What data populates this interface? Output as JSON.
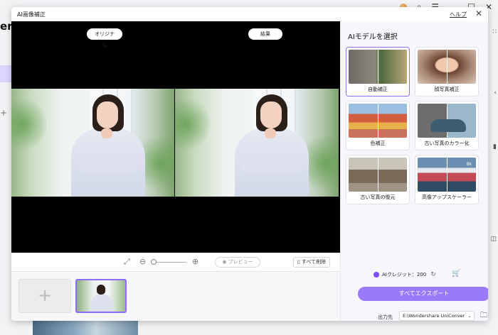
{
  "background": {
    "app_title": "er",
    "plus": "+",
    "top_icons": [
      "avatar-icon",
      "search-icon",
      "menu-icon",
      "minimize-icon",
      "maximize-icon",
      "close-icon"
    ]
  },
  "dialog": {
    "title": "AI画像補正",
    "help": "ヘルプ",
    "close": "✕"
  },
  "preview": {
    "original_label": "オリジナル",
    "result_label": "結果"
  },
  "toolbar": {
    "preview_label": "プレビュー",
    "delete_all_label": "すべて削除"
  },
  "strip": {
    "add_label": "+"
  },
  "panel": {
    "title": "AIモデルを選択",
    "models": [
      {
        "label": "自動補正",
        "selected": true
      },
      {
        "label": "顔写真補正",
        "selected": false
      },
      {
        "label": "色補正",
        "selected": false
      },
      {
        "label": "古い写真のカラー化",
        "selected": false
      },
      {
        "label": "古い写真の復元",
        "selected": false
      },
      {
        "label": "高像アップスケーラー",
        "selected": false,
        "badge": "8k"
      }
    ],
    "credits_label": "AIクレジット：200",
    "export_label": "すべてエクスポート",
    "output_label": "出力先",
    "output_path": "E:\\Wondershare UniConver"
  },
  "colors": {
    "accent": "#8f6cf6",
    "export_button": "#9a79f7",
    "preview_bg": "#000000"
  }
}
